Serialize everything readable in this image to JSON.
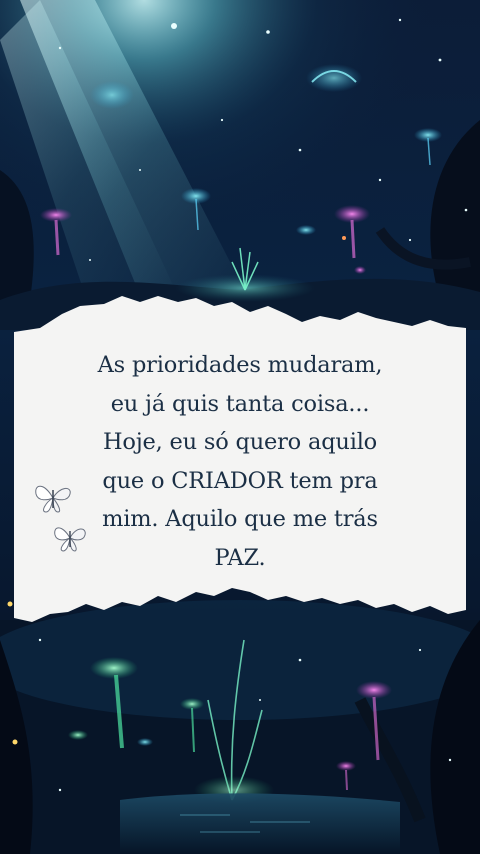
{
  "quote": {
    "lines": [
      "As prioridades mudaram,",
      "eu já quis tanta coisa...",
      "Hoje, eu só quero aquilo",
      "que o CRIADOR tem pra",
      "mim. Aquilo que me trás",
      "PAZ."
    ]
  },
  "decorations": {
    "top_scene": "enchanted-night-forest-with-glowing-mushrooms",
    "bottom_scene": "glowing-mushroom-forest-by-water",
    "paper": "torn-paper-strip",
    "butterflies": [
      "butterfly-icon",
      "butterfly-icon"
    ]
  },
  "colors": {
    "sky_dark": "#050b1a",
    "glow_cyan": "#5ff2ff",
    "glow_magenta": "#e24fd9",
    "glow_green": "#5dff9a",
    "paper": "#f4f4f3",
    "text": "#1b2f45"
  }
}
